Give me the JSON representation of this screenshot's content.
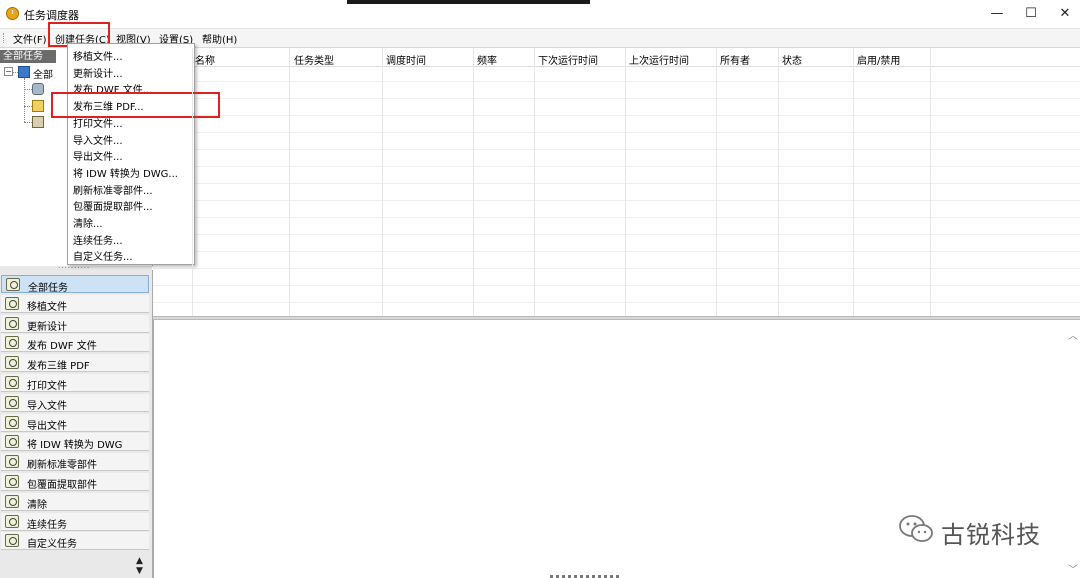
{
  "window": {
    "title": "任务调度器",
    "controls": {
      "minimize": "—",
      "maximize": "☐",
      "close": "✕"
    }
  },
  "menubar": {
    "file": "文件(F)",
    "create_task": "创建任务(C)",
    "view": "视图(V)",
    "settings": "设置(S)",
    "help": "帮助(H)"
  },
  "dropdown": {
    "items": [
      "移植文件...",
      "更新设计...",
      "发布 DWF 文件...",
      "发布三维 PDF...",
      "打印文件...",
      "导入文件...",
      "导出文件...",
      "将 IDW 转换为 DWG...",
      "刷新标准零部件...",
      "包覆面提取部件...",
      "清除...",
      "连续任务...",
      "自定义任务..."
    ],
    "highlighted": "发布三维 PDF..."
  },
  "tree": {
    "header": "全部任务",
    "root_label": "全部",
    "expand_glyph": "−"
  },
  "table": {
    "columns": [
      "名称",
      "任务类型",
      "调度时间",
      "频率",
      "下次运行时间",
      "上次运行时间",
      "所有者",
      "状态",
      "启用/禁用"
    ]
  },
  "categories": {
    "items": [
      "全部任务",
      "移植文件",
      "更新设计",
      "发布 DWF 文件",
      "发布三维 PDF",
      "打印文件",
      "导入文件",
      "导出文件",
      "将 IDW 转换为 DWG",
      "刷新标准零部件",
      "包覆面提取部件",
      "清除",
      "连续任务",
      "自定义任务"
    ],
    "selected": "全部任务"
  },
  "watermark": "古锐科技",
  "colors": {
    "highlight_box": "#e02020",
    "selected_row": "#cde2f5",
    "tree_header": "#6b6b6b"
  }
}
